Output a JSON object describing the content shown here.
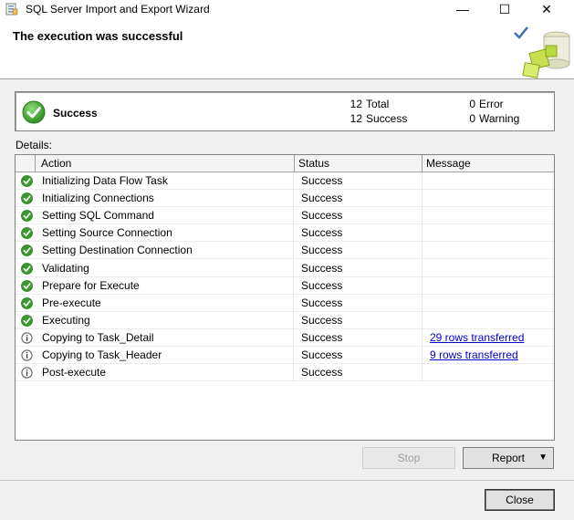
{
  "window": {
    "title": "SQL Server Import and Export Wizard",
    "minimize_glyph": "—",
    "maximize_glyph": "☐",
    "close_glyph": "✕"
  },
  "header": {
    "title": "The execution was successful"
  },
  "summary": {
    "status": "Success",
    "total_count": "12",
    "total_label": "Total",
    "success_count": "12",
    "success_label": "Success",
    "error_count": "0",
    "error_label": "Error",
    "warning_count": "0",
    "warning_label": "Warning"
  },
  "details": {
    "label": "Details:",
    "columns": {
      "action": "Action",
      "status": "Status",
      "message": "Message"
    },
    "rows": [
      {
        "icon": "success-icon",
        "action": "Initializing Data Flow Task",
        "status": "Success",
        "message": ""
      },
      {
        "icon": "success-icon",
        "action": "Initializing Connections",
        "status": "Success",
        "message": ""
      },
      {
        "icon": "success-icon",
        "action": "Setting SQL Command",
        "status": "Success",
        "message": ""
      },
      {
        "icon": "success-icon",
        "action": "Setting Source Connection",
        "status": "Success",
        "message": ""
      },
      {
        "icon": "success-icon",
        "action": "Setting Destination Connection",
        "status": "Success",
        "message": ""
      },
      {
        "icon": "success-icon",
        "action": "Validating",
        "status": "Success",
        "message": ""
      },
      {
        "icon": "success-icon",
        "action": "Prepare for Execute",
        "status": "Success",
        "message": ""
      },
      {
        "icon": "success-icon",
        "action": "Pre-execute",
        "status": "Success",
        "message": ""
      },
      {
        "icon": "success-icon",
        "action": "Executing",
        "status": "Success",
        "message": ""
      },
      {
        "icon": "info-icon",
        "action": "Copying to Task_Detail",
        "status": "Success",
        "message": "29 rows transferred"
      },
      {
        "icon": "info-icon",
        "action": "Copying to Task_Header",
        "status": "Success",
        "message": "9 rows transferred"
      },
      {
        "icon": "info-icon",
        "action": "Post-execute",
        "status": "Success",
        "message": ""
      }
    ]
  },
  "buttons": {
    "stop": "Stop",
    "report": "Report",
    "report_caret": "▼",
    "close": "Close"
  },
  "colors": {
    "success_green": "#3a9a2f",
    "link_blue": "#0000cc"
  }
}
